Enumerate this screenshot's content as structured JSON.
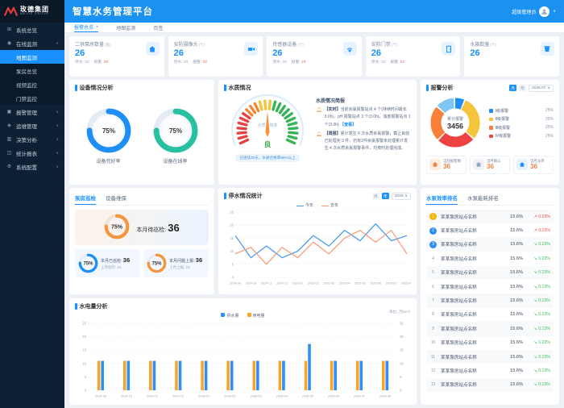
{
  "logo": {
    "name": "玫德集团",
    "sub": "MEIDE GROUP"
  },
  "header": {
    "title": "智慧水务管理平台",
    "user": "超级管理员"
  },
  "sidebar": {
    "items": [
      {
        "label": "系统总览",
        "icon": "overview-icon",
        "chev": false
      },
      {
        "label": "在线监测",
        "icon": "monitor-icon",
        "chev": true,
        "expanded": true,
        "children": [
          {
            "label": "地图监测",
            "active": true
          },
          {
            "label": "泵房总览",
            "active": false
          },
          {
            "label": "视频监控",
            "active": false
          },
          {
            "label": "门禁监控",
            "active": false
          }
        ]
      },
      {
        "label": "报警管理",
        "icon": "alarm-icon",
        "chev": true
      },
      {
        "label": "运维管理",
        "icon": "ops-icon",
        "chev": true
      },
      {
        "label": "决策分析",
        "icon": "analysis-icon",
        "chev": true
      },
      {
        "label": "统计报表",
        "icon": "report-icon",
        "chev": true
      },
      {
        "label": "系统配置",
        "icon": "config-icon",
        "chev": true
      }
    ]
  },
  "tabs": [
    {
      "label": "报警总览",
      "active": true,
      "closable": true
    },
    {
      "label": "地图监测",
      "active": false,
      "closable": false
    },
    {
      "label": "页签",
      "active": false,
      "closable": false
    }
  ],
  "stat_cards": [
    {
      "title": "二供泵房数量",
      "unit": "(座)",
      "value": "26",
      "stop_label": "停水:",
      "stop_value": "20",
      "alarm_label": "报警:",
      "alarm_value": "20",
      "icon": "home-icon"
    },
    {
      "title": "安防摄像头",
      "unit": "(个)",
      "value": "26",
      "stop_label": "停水:",
      "stop_value": "20",
      "alarm_label": "报警:",
      "alarm_value": "23",
      "icon": "camera-icon"
    },
    {
      "title": "传感器设备",
      "unit": "(个)",
      "value": "26",
      "stop_label": "停水:",
      "stop_value": "20",
      "alarm_label": "报警:",
      "alarm_value": "23",
      "icon": "sensor-icon"
    },
    {
      "title": "安防门禁",
      "unit": "(个)",
      "value": "26",
      "stop_label": "停水:",
      "stop_value": "20",
      "alarm_label": "报警:",
      "alarm_value": "23",
      "icon": "door-icon"
    },
    {
      "title": "水箱数量",
      "unit": "(个)",
      "value": "26",
      "stop_label": "",
      "stop_value": "",
      "alarm_label": "",
      "alarm_value": "",
      "icon": "tank-icon"
    }
  ],
  "device_panel": {
    "title": "设备情况分析",
    "donuts": [
      {
        "pct": 75,
        "label": "设备完好率",
        "color": "#1e8ff7"
      },
      {
        "pct": 75,
        "label": "设备在线率",
        "color": "#27c0a1"
      }
    ]
  },
  "water_panel": {
    "title": "水质情况",
    "gauge_label": "水质合格率",
    "grade": "良",
    "banner": "已连续30天，水质合格率96%以上",
    "report_title": "水质情况简报",
    "reports": [
      {
        "tag": "【实时】",
        "text": "当前余氯报警站点 4 个(持续时间最长3.0h)，pH 报警站点 3 个(3.0h)，浊度报警站点 1 个(3.0h)",
        "link": "【查看】"
      },
      {
        "tag": "【周报】",
        "text": "累计发生 6 次水质余氯报警，截止目前已处理完 3 件，仍有2件余氯报警未处理累计发生 4 次水质余氯报警事件，均按时处理完成。",
        "link": ""
      }
    ]
  },
  "alarm_panel": {
    "title": "报警分析",
    "toggle": [
      "月",
      "年"
    ],
    "toggle_active": 0,
    "period": "2025.07",
    "center_label": "累计报警",
    "center_value": "3456",
    "segments": [
      {
        "color": "#1e8ff7",
        "frac": 0.07
      },
      {
        "color": "#f6c43b",
        "frac": 0.3
      },
      {
        "color": "#ef4242",
        "frac": 0.26
      },
      {
        "color": "#f8803b",
        "frac": 0.24
      },
      {
        "color": "#7fc6f3",
        "frac": 0.13
      }
    ],
    "legend": [
      {
        "label": "Ⅰ级报警",
        "pct": "25%",
        "color": "#1e8ff7"
      },
      {
        "label": "Ⅱ级报警",
        "pct": "25%",
        "color": "#f6c43b"
      },
      {
        "label": "Ⅲ级报警",
        "pct": "25%",
        "color": "#f8803b"
      },
      {
        "label": "Ⅳ级报警",
        "pct": "25%",
        "color": "#ef4242"
      }
    ],
    "stats": [
      {
        "label": "当前报警数",
        "value": "36",
        "theme": "orange"
      },
      {
        "label": "当月确认",
        "value": "36",
        "theme": "gray"
      },
      {
        "label": "当月派单",
        "value": "36",
        "theme": "blue"
      }
    ]
  },
  "inspection_panel": {
    "tabs": [
      "泵房巡检",
      "设备维保"
    ],
    "active_tab": 0,
    "main": {
      "pct": 75,
      "label": "本月待巡检:",
      "value": "36",
      "color": "#f5953f"
    },
    "cards": [
      {
        "pct": 75,
        "label": "本月已巡检:",
        "value": "36",
        "sub": "上月巡检: 23",
        "color": "#1e8ff7"
      },
      {
        "pct": 75,
        "label": "本月问题上报:",
        "value": "36",
        "sub": "上月上报: 23",
        "color": "#f5953f"
      }
    ]
  },
  "outage_panel": {
    "title": "停水情况统计",
    "toggle": [
      "月",
      "年"
    ],
    "toggle_active": 1,
    "period": "2025",
    "chart_data": {
      "type": "line",
      "ylim": [
        0,
        25
      ],
      "yticks": [
        0,
        5,
        10,
        15,
        20,
        25
      ],
      "grid": true,
      "legend_position": "top",
      "categories": [
        "2024-09",
        "2024-10",
        "2024-11",
        "2024-12",
        "2025-01",
        "2025-02",
        "2025-03",
        "2025-04",
        "2025-05",
        "2025-06",
        "2025-07",
        "2025-08"
      ],
      "series": [
        {
          "name": "今年",
          "color": "#3c96f0",
          "values": [
            16,
            7.5,
            12,
            7.5,
            10,
            16,
            12,
            18,
            14,
            20.5,
            14,
            16
          ]
        },
        {
          "name": "去年",
          "color": "#f59a70",
          "values": [
            9,
            11.5,
            5,
            11.5,
            7.5,
            13.5,
            9,
            15,
            18,
            13.5,
            18,
            9
          ]
        }
      ]
    }
  },
  "ranking_panel": {
    "tabs": [
      "水泵效率排名",
      "水泵能耗排名"
    ],
    "active_tab": 0,
    "rows": [
      {
        "rank": 1,
        "name": "某某泵房站点名称",
        "value": "15.6%",
        "change": "0.23%",
        "dir": "up"
      },
      {
        "rank": 2,
        "name": "某某泵房站点名称",
        "value": "15.6%",
        "change": "0.23%",
        "dir": "up"
      },
      {
        "rank": 3,
        "name": "某某泵房站点名称",
        "value": "15.6%",
        "change": "0.23%",
        "dir": "down"
      },
      {
        "rank": 4,
        "name": "某某泵房站点名称",
        "value": "15.6%",
        "change": "0.23%",
        "dir": "down"
      },
      {
        "rank": 5,
        "name": "某某泵房站点名称",
        "value": "15.6%",
        "change": "0.23%",
        "dir": "down"
      },
      {
        "rank": 6,
        "name": "某某泵房站点名称",
        "value": "15.6%",
        "change": "0.23%",
        "dir": "down"
      },
      {
        "rank": 7,
        "name": "某某泵房站点名称",
        "value": "15.6%",
        "change": "0.23%",
        "dir": "down"
      },
      {
        "rank": 8,
        "name": "某某泵房站点名称",
        "value": "15.6%",
        "change": "0.23%",
        "dir": "down"
      },
      {
        "rank": 9,
        "name": "某某泵房站点名称",
        "value": "15.6%",
        "change": "0.23%",
        "dir": "down"
      },
      {
        "rank": 10,
        "name": "某某泵房站点名称",
        "value": "15.6%",
        "change": "0.23%",
        "dir": "down"
      },
      {
        "rank": 11,
        "name": "某某泵房站点名称",
        "value": "15.6%",
        "change": "0.23%",
        "dir": "down"
      },
      {
        "rank": 12,
        "name": "某某泵房站点名称",
        "value": "15.6%",
        "change": "0.23%",
        "dir": "down"
      },
      {
        "rank": 13,
        "name": "某某泵房站点名称",
        "value": "15.6%",
        "change": "0.23%",
        "dir": "down"
      }
    ]
  },
  "energy_panel": {
    "title": "水电量分析",
    "unit": "单位: 万kw·h",
    "chart_data": {
      "type": "bar",
      "ylim": [
        0,
        25
      ],
      "yticks": [
        0,
        5,
        10,
        15,
        20,
        25
      ],
      "grid": true,
      "legend_position": "top",
      "dual_axis": true,
      "categories": [
        "2024-09",
        "2024-10",
        "2024-11",
        "2024-12",
        "2025-01",
        "2025-02",
        "2025-03",
        "2025-04",
        "2025-05",
        "2025-06",
        "2025-07",
        "2025-08"
      ],
      "series": [
        {
          "name": "供水量",
          "color": "#2f8ff2",
          "values": [
            11,
            11,
            11,
            11,
            11,
            11,
            11,
            11,
            17.3,
            11,
            11,
            11
          ]
        },
        {
          "name": "用电量",
          "color": "#f7a42c",
          "values": [
            11,
            11,
            11,
            11,
            11,
            11,
            11,
            11,
            11,
            11,
            11,
            11
          ]
        }
      ]
    }
  }
}
